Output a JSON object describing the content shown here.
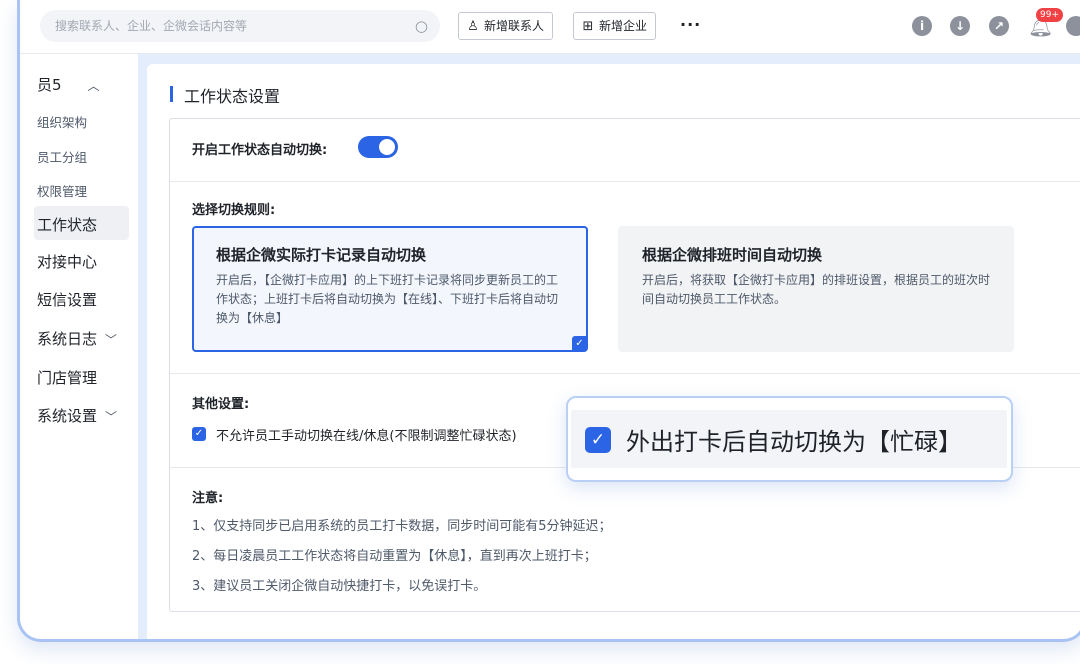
{
  "topbar": {
    "search_placeholder": "搜索联系人、企业、企微会话内容等",
    "new_contact": "新增联系人",
    "new_company": "新增企业",
    "more": "···",
    "info_icon": "i",
    "download_icon": "↓",
    "share_icon": "↗",
    "badge": "99+"
  },
  "sidebar": {
    "group": "员5",
    "items": [
      {
        "label": "组织架构"
      },
      {
        "label": "员工分组"
      },
      {
        "label": "权限管理"
      },
      {
        "label": "工作状态"
      },
      {
        "label": "对接中心"
      },
      {
        "label": "短信设置"
      },
      {
        "label": "系统日志"
      },
      {
        "label": "门店管理"
      },
      {
        "label": "系统设置"
      }
    ]
  },
  "main": {
    "title": "工作状态设置",
    "auto_switch_label": "开启工作状态自动切换:",
    "auto_switch_on": true,
    "rule_label": "选择切换规则:",
    "option1": {
      "title": "根据企微实际打卡记录自动切换",
      "desc": "开启后，【企微打卡应用】的上下班打卡记录将同步更新员工的工作状态；上班打卡后将自动切换为【在线】、下班打卡后将自动切换为【休息】"
    },
    "option2": {
      "title": "根据企微排班时间自动切换",
      "desc": "开启后，将获取【企微打卡应用】的排班设置，根据员工的班次时间自动切换员工工作状态。"
    },
    "other_label": "其他设置:",
    "other_checkbox": "不允许员工手动切换在线/休息(不限制调整忙碌状态)",
    "notes_label": "注意:",
    "notes": [
      "1、仅支持同步已启用系统的员工打卡数据，同步时间可能有5分钟延迟；",
      "2、每日凌晨员工工作状态将自动重置为【休息】，直到再次上班打卡；",
      "3、建议员工关闭企微自动快捷打卡，以免误打卡。"
    ]
  },
  "popout": {
    "text": "外出打卡后自动切换为【忙碌】"
  },
  "colors": {
    "accent": "#2b64e4",
    "badge": "#f04144",
    "frame": "#a9c4f2"
  }
}
